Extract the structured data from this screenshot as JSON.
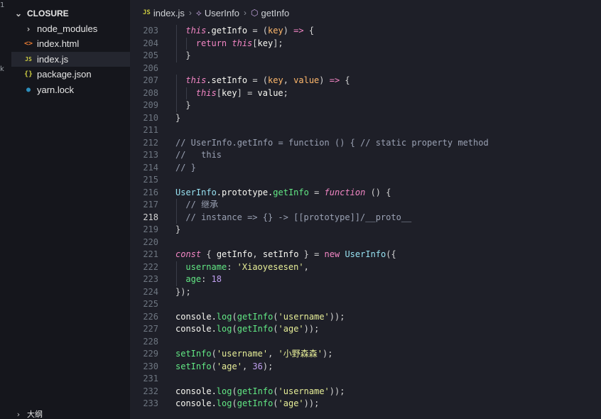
{
  "activity": {
    "glyphs": [
      "1",
      "k"
    ]
  },
  "explorer": {
    "folder": "CLOSURE",
    "files": [
      {
        "name": "node_modules",
        "type": "folder",
        "icon": "chevron-right-icon"
      },
      {
        "name": "index.html",
        "type": "html",
        "icon": "html-icon",
        "icon_text": "<>",
        "color": "#e37933"
      },
      {
        "name": "index.js",
        "type": "js",
        "icon": "js-icon",
        "icon_text": "JS",
        "color": "#cbcb41",
        "active": true
      },
      {
        "name": "package.json",
        "type": "json",
        "icon": "json-icon",
        "icon_text": "{}",
        "color": "#cbcb41"
      },
      {
        "name": "yarn.lock",
        "type": "lock",
        "icon": "yarn-icon",
        "icon_text": "●",
        "color": "#2c8ebb"
      }
    ],
    "outline_label": "大纲"
  },
  "breadcrumb": {
    "file_badge": "JS",
    "file": "index.js",
    "symbol1": "UserInfo",
    "symbol2": "getInfo"
  },
  "editor": {
    "current_line": 218,
    "lines": [
      {
        "n": 203,
        "indent": 1,
        "tokens": [
          [
            "kwi",
            "this"
          ],
          [
            "prop",
            ".getInfo "
          ],
          [
            "br",
            "= ("
          ],
          [
            "par",
            "key"
          ],
          [
            "br",
            ") "
          ],
          [
            "kw",
            "=>"
          ],
          [
            "br",
            " {"
          ]
        ]
      },
      {
        "n": 204,
        "indent": 2,
        "tokens": [
          [
            "kw",
            "return "
          ],
          [
            "kwi",
            "this"
          ],
          [
            "br",
            "["
          ],
          [
            "prop",
            "key"
          ],
          [
            "br",
            "];"
          ]
        ]
      },
      {
        "n": 205,
        "indent": 1,
        "tokens": [
          [
            "br",
            "}"
          ]
        ]
      },
      {
        "n": 206,
        "indent": 0,
        "tokens": []
      },
      {
        "n": 207,
        "indent": 1,
        "tokens": [
          [
            "kwi",
            "this"
          ],
          [
            "prop",
            ".setInfo "
          ],
          [
            "br",
            "= ("
          ],
          [
            "par",
            "key"
          ],
          [
            "br",
            ", "
          ],
          [
            "par",
            "value"
          ],
          [
            "br",
            ") "
          ],
          [
            "kw",
            "=>"
          ],
          [
            "br",
            " {"
          ]
        ]
      },
      {
        "n": 208,
        "indent": 2,
        "tokens": [
          [
            "kwi",
            "this"
          ],
          [
            "br",
            "["
          ],
          [
            "prop",
            "key"
          ],
          [
            "br",
            "] = "
          ],
          [
            "prop",
            "value"
          ],
          [
            "br",
            ";"
          ]
        ]
      },
      {
        "n": 209,
        "indent": 1,
        "tokens": [
          [
            "br",
            "}"
          ]
        ]
      },
      {
        "n": 210,
        "indent": 0,
        "tokens": [
          [
            "br",
            "}"
          ]
        ]
      },
      {
        "n": 211,
        "indent": 0,
        "tokens": []
      },
      {
        "n": 212,
        "indent": 0,
        "tokens": [
          [
            "cm",
            "// UserInfo.getInfo = function () { // static property method"
          ]
        ]
      },
      {
        "n": 213,
        "indent": 0,
        "tokens": [
          [
            "cm",
            "//   this"
          ]
        ]
      },
      {
        "n": 214,
        "indent": 0,
        "tokens": [
          [
            "cm",
            "// }"
          ]
        ]
      },
      {
        "n": 215,
        "indent": 0,
        "tokens": []
      },
      {
        "n": 216,
        "indent": 0,
        "tokens": [
          [
            "cls",
            "UserInfo"
          ],
          [
            "prop",
            ".prototype."
          ],
          [
            "fn",
            "getInfo"
          ],
          [
            "br",
            " = "
          ],
          [
            "kwi",
            "function"
          ],
          [
            "br",
            " () {"
          ]
        ]
      },
      {
        "n": 217,
        "indent": 1,
        "tokens": [
          [
            "cm",
            "// 继承"
          ]
        ]
      },
      {
        "n": 218,
        "indent": 1,
        "tokens": [
          [
            "cm",
            "// instance => {} -> [[prototype]]/__proto__"
          ]
        ]
      },
      {
        "n": 219,
        "indent": 0,
        "tokens": [
          [
            "br",
            "}"
          ]
        ]
      },
      {
        "n": 220,
        "indent": 0,
        "tokens": []
      },
      {
        "n": 221,
        "indent": 0,
        "tokens": [
          [
            "kwi",
            "const"
          ],
          [
            "br",
            " { "
          ],
          [
            "prop",
            "getInfo"
          ],
          [
            "br",
            ", "
          ],
          [
            "prop",
            "setInfo"
          ],
          [
            "br",
            " } = "
          ],
          [
            "kw",
            "new "
          ],
          [
            "cls",
            "UserInfo"
          ],
          [
            "br",
            "({"
          ]
        ]
      },
      {
        "n": 222,
        "indent": 1,
        "tokens": [
          [
            "fn",
            "username"
          ],
          [
            "br",
            ": "
          ],
          [
            "str",
            "'Xiaoyesesen'"
          ],
          [
            "br",
            ","
          ]
        ]
      },
      {
        "n": 223,
        "indent": 1,
        "tokens": [
          [
            "fn",
            "age"
          ],
          [
            "br",
            ": "
          ],
          [
            "num",
            "18"
          ]
        ]
      },
      {
        "n": 224,
        "indent": 0,
        "tokens": [
          [
            "br",
            "});"
          ]
        ]
      },
      {
        "n": 225,
        "indent": 0,
        "tokens": []
      },
      {
        "n": 226,
        "indent": 0,
        "tokens": [
          [
            "prop",
            "console."
          ],
          [
            "fn",
            "log"
          ],
          [
            "br",
            "("
          ],
          [
            "fn",
            "getInfo"
          ],
          [
            "br",
            "("
          ],
          [
            "str",
            "'username'"
          ],
          [
            "br",
            "));"
          ]
        ]
      },
      {
        "n": 227,
        "indent": 0,
        "tokens": [
          [
            "prop",
            "console."
          ],
          [
            "fn",
            "log"
          ],
          [
            "br",
            "("
          ],
          [
            "fn",
            "getInfo"
          ],
          [
            "br",
            "("
          ],
          [
            "str",
            "'age'"
          ],
          [
            "br",
            "));"
          ]
        ]
      },
      {
        "n": 228,
        "indent": 0,
        "tokens": []
      },
      {
        "n": 229,
        "indent": 0,
        "tokens": [
          [
            "fn",
            "setInfo"
          ],
          [
            "br",
            "("
          ],
          [
            "str",
            "'username'"
          ],
          [
            "br",
            ", "
          ],
          [
            "str",
            "'小野森森'"
          ],
          [
            "br",
            ");"
          ]
        ]
      },
      {
        "n": 230,
        "indent": 0,
        "tokens": [
          [
            "fn",
            "setInfo"
          ],
          [
            "br",
            "("
          ],
          [
            "str",
            "'age'"
          ],
          [
            "br",
            ", "
          ],
          [
            "num",
            "36"
          ],
          [
            "br",
            ");"
          ]
        ]
      },
      {
        "n": 231,
        "indent": 0,
        "tokens": []
      },
      {
        "n": 232,
        "indent": 0,
        "tokens": [
          [
            "prop",
            "console."
          ],
          [
            "fn",
            "log"
          ],
          [
            "br",
            "("
          ],
          [
            "fn",
            "getInfo"
          ],
          [
            "br",
            "("
          ],
          [
            "str",
            "'username'"
          ],
          [
            "br",
            "));"
          ]
        ]
      },
      {
        "n": 233,
        "indent": 0,
        "tokens": [
          [
            "prop",
            "console."
          ],
          [
            "fn",
            "log"
          ],
          [
            "br",
            "("
          ],
          [
            "fn",
            "getInfo"
          ],
          [
            "br",
            "("
          ],
          [
            "str",
            "'age'"
          ],
          [
            "br",
            "));"
          ]
        ]
      }
    ]
  }
}
